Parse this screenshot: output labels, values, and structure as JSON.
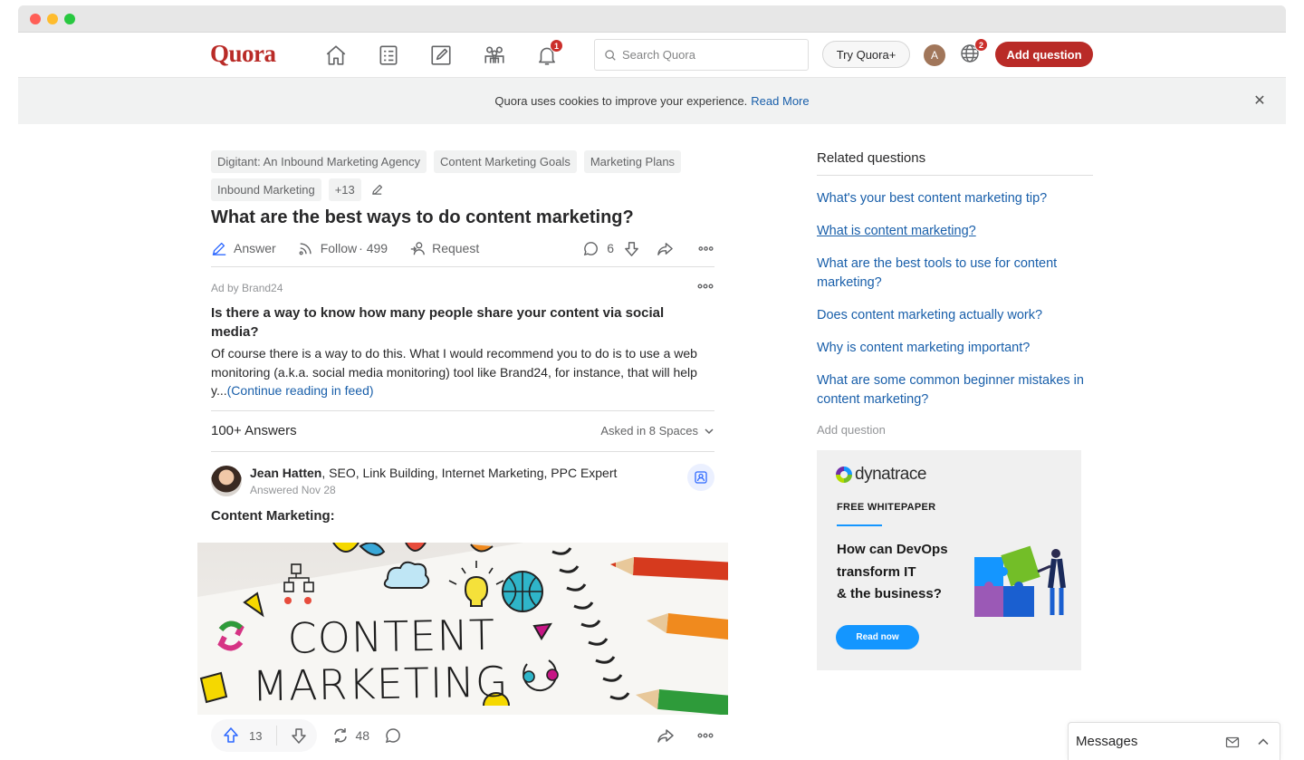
{
  "nav": {
    "logo": "Quora",
    "notifications_badge": "1",
    "search_placeholder": "Search Quora",
    "try_label": "Try Quora+",
    "avatar_letter": "A",
    "language_badge": "2",
    "add_question_label": "Add question",
    "brand_color": "#b92b27"
  },
  "cookie": {
    "text": "Quora uses cookies to improve your experience.",
    "link": "Read More"
  },
  "question": {
    "topics": [
      "Digitant: An Inbound Marketing Agency",
      "Content Marketing Goals",
      "Marketing Plans",
      "Inbound Marketing",
      "+13"
    ],
    "title": "What are the best ways to do content marketing?",
    "answer_label": "Answer",
    "follow_label": "Follow",
    "follow_count": "· 499",
    "request_label": "Request",
    "comments_count": "6"
  },
  "ad": {
    "label": "Ad by Brand24",
    "more": "•••",
    "title": "Is there a way to know how many people share your content via social media?",
    "body": "Of course there is a way to do this. What I would recommend you to do is to use a web monitoring (a.k.a. social media monitoring) tool like Brand24, for instance, that will help y...",
    "continue": "(Continue reading in feed)"
  },
  "answers": {
    "count_label": "100+ Answers",
    "asked_in": "Asked in 8 Spaces"
  },
  "answer": {
    "author": "Jean Hatten",
    "credentials": ", SEO, Link Building, Internet Marketing, PPC Expert",
    "date": "Answered Nov 28",
    "heading": "Content Marketing:",
    "image_text_1": "CONTENT",
    "image_text_2": "MARKETING",
    "upvotes": "13",
    "shares": "48",
    "more": "•••"
  },
  "sidebar": {
    "title": "Related questions",
    "related": [
      "What's your best content marketing tip?",
      "What is content marketing?",
      "What are the best tools to use for content marketing?",
      "Does content marketing actually work?",
      "Why is content marketing important?",
      "What are some common beginner mistakes in content marketing?"
    ],
    "add_question": "Add question"
  },
  "sponsor": {
    "brand": "dynatrace",
    "label": "FREE WHITEPAPER",
    "headline_1": "How can DevOps",
    "headline_2": "transform IT",
    "headline_3": "& the business?",
    "cta": "Read now",
    "accent": "#1496ff"
  },
  "messages": {
    "label": "Messages"
  }
}
